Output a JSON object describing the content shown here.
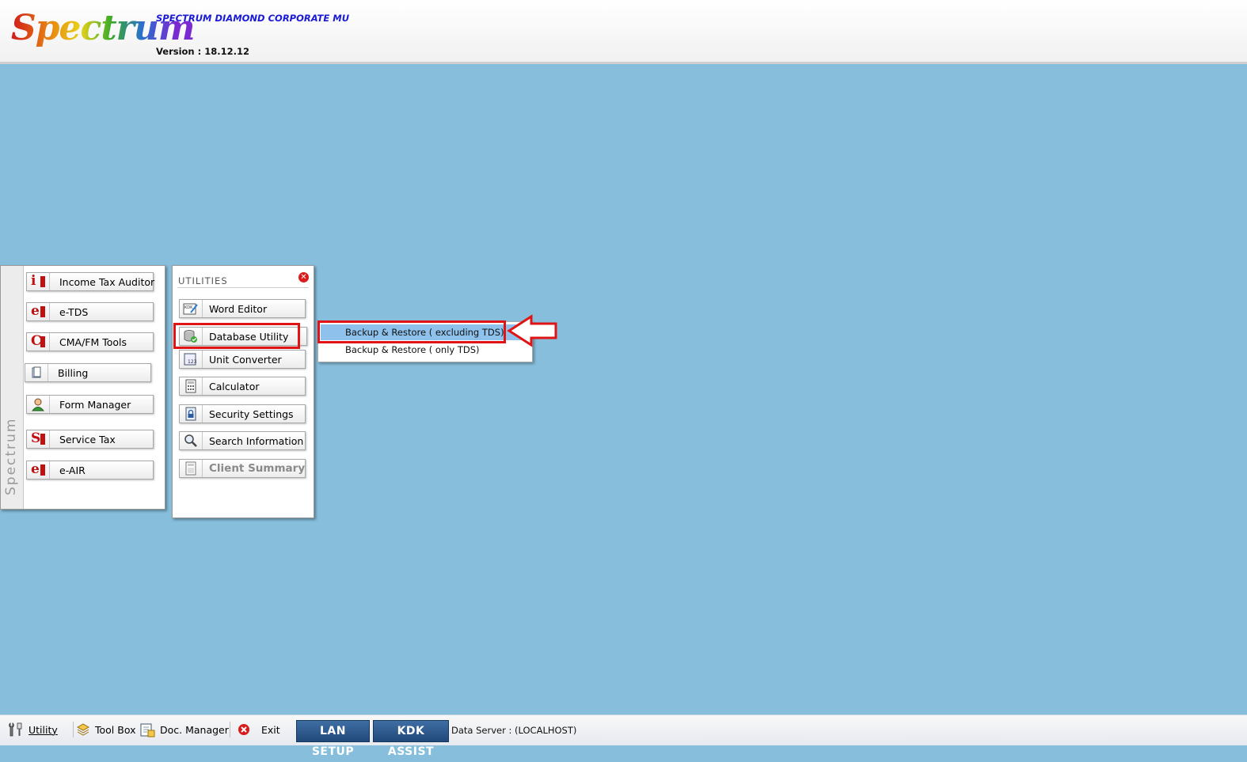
{
  "app": {
    "logo": "Spectrum",
    "corporate": "SPECTRUM DIAMOND CORPORATE MU",
    "version": "Version : 18.12.12"
  },
  "left_menu": {
    "side_label": "Spectrum",
    "items": [
      {
        "label": "Income Tax Auditor",
        "icon": "income-tax-icon"
      },
      {
        "label": "e-TDS",
        "icon": "etds-icon"
      },
      {
        "label": "CMA/FM Tools",
        "icon": "cma-icon"
      },
      {
        "label": "Billing",
        "icon": "billing-icon"
      },
      {
        "label": "Form Manager",
        "icon": "form-manager-icon"
      },
      {
        "label": "Service Tax",
        "icon": "service-tax-icon"
      },
      {
        "label": "e-AIR",
        "icon": "eair-icon"
      }
    ]
  },
  "utilities": {
    "title": "UTILITIES",
    "items": [
      {
        "label": "Word Editor",
        "icon": "word-editor-icon"
      },
      {
        "label": "Database Utility",
        "icon": "database-icon"
      },
      {
        "label": "Unit Converter",
        "icon": "unit-converter-icon"
      },
      {
        "label": "Calculator",
        "icon": "calculator-icon"
      },
      {
        "label": "Security Settings",
        "icon": "lock-icon"
      },
      {
        "label": "Search Information",
        "icon": "search-icon"
      },
      {
        "label": "Client Summary",
        "icon": "client-summary-icon"
      }
    ]
  },
  "submenu": {
    "items": [
      {
        "label": "Backup & Restore ( excluding TDS)",
        "highlighted": true
      },
      {
        "label": "Backup & Restore ( only TDS)",
        "highlighted": false
      }
    ]
  },
  "taskbar": {
    "utility": "Utility",
    "toolbox": "Tool Box",
    "doc_manager": "Doc. Manager",
    "exit": "Exit",
    "lan_setup": "LAN SETUP",
    "kdk_assist": "KDK ASSIST",
    "data_server": "Data Server : (LOCALHOST)"
  },
  "colors": {
    "background": "#86bedc",
    "highlight_box": "#e01414",
    "menu_highlight": "#8ec2ed",
    "corporate_text": "#1a1ad6"
  }
}
